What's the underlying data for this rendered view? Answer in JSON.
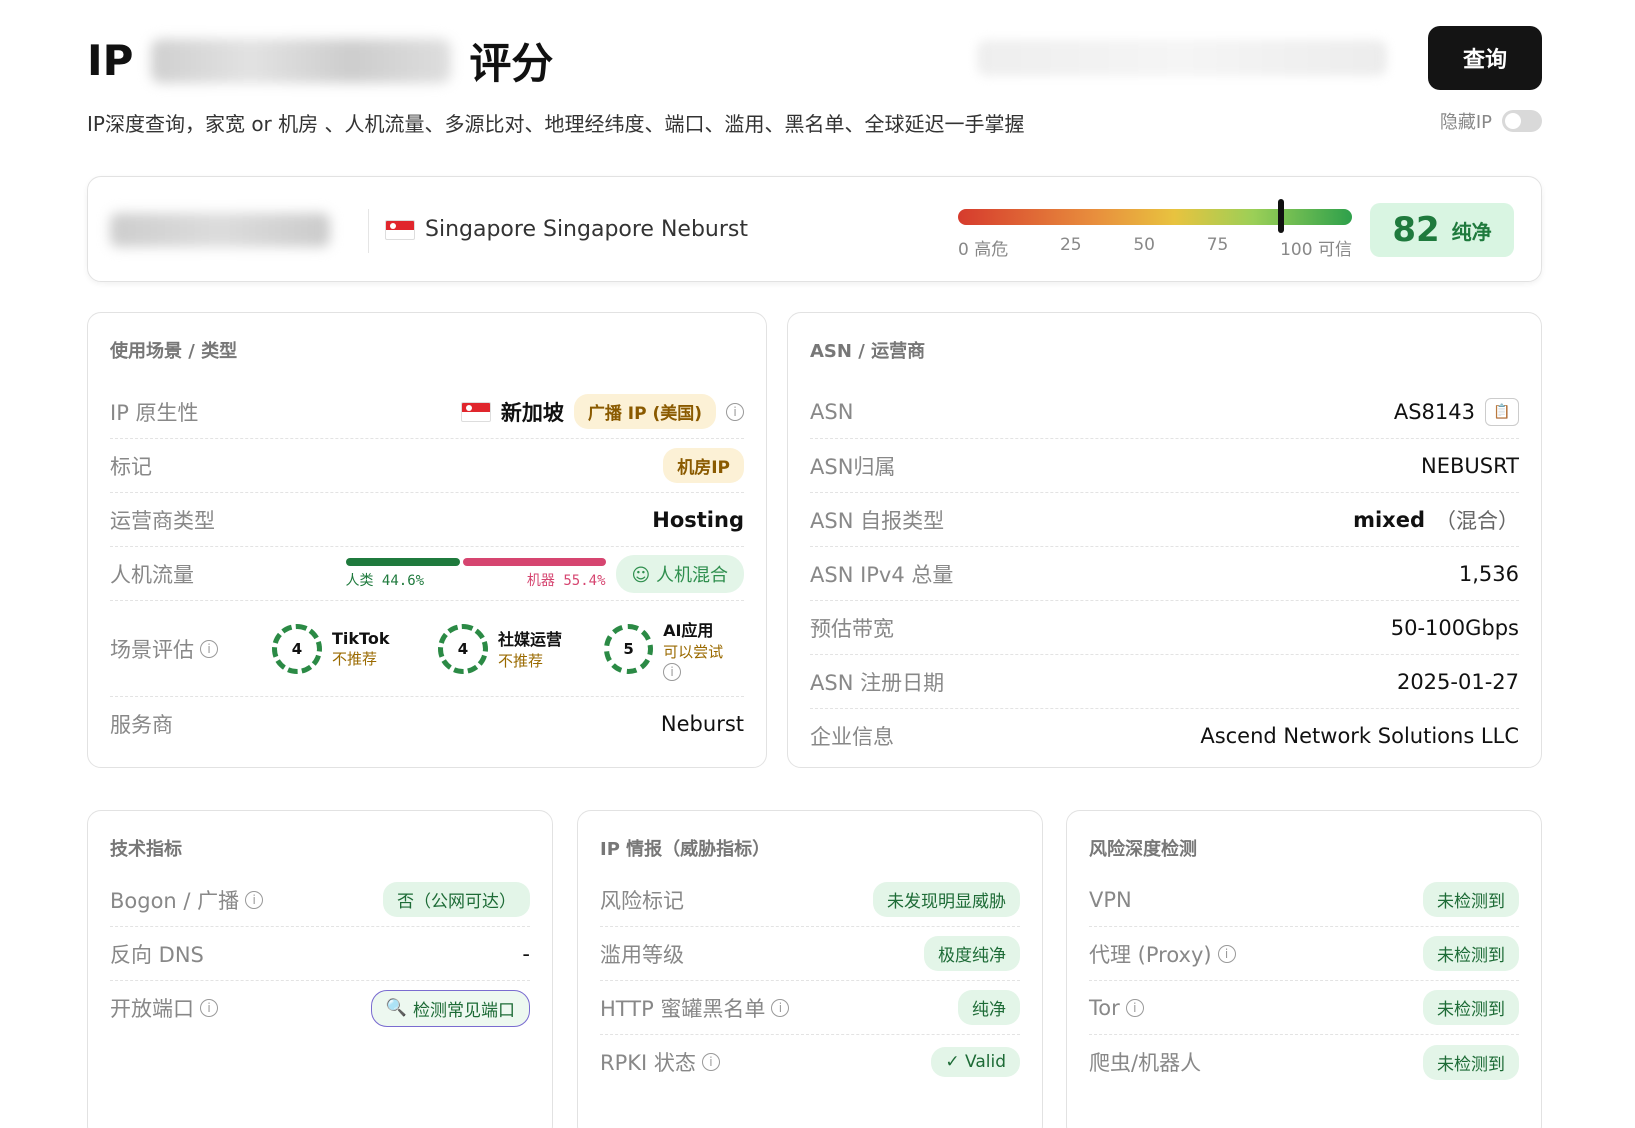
{
  "header": {
    "title_prefix": "IP",
    "title_suffix": "评分",
    "query_button": "查询",
    "subtitle": "IP深度查询，家宽 or 机房 、人机流量、多源比对、地理经纬度、端口、滥用、黑名单、全球延迟一手掌握",
    "hide_ip_label": "隐藏IP"
  },
  "summary": {
    "location": "Singapore Singapore Neburst",
    "gauge_ticks": [
      "0 高危",
      "25",
      "50",
      "75",
      "100 可信"
    ],
    "score": 82,
    "score_label": "纯净"
  },
  "usage": {
    "title": "使用场景 / 类型",
    "native_label": "IP 原生性",
    "native_country": "新加坡",
    "native_badge": "广播 IP (美国)",
    "tag_label": "标记",
    "tag_value": "机房IP",
    "carrier_type_label": "运营商类型",
    "carrier_type_value": "Hosting",
    "traffic_label": "人机流量",
    "human_label": "人类 44.6%",
    "bot_label": "机器 55.4%",
    "human_pct": 44.6,
    "bot_pct": 55.4,
    "traffic_verdict": "人机混合",
    "scene_label": "场景评估",
    "scenes": [
      {
        "score": "4",
        "name": "TikTok",
        "verdict": "不推荐"
      },
      {
        "score": "4",
        "name": "社媒运营",
        "verdict": "不推荐"
      },
      {
        "score": "5",
        "name": "AI应用",
        "verdict": "可以尝试"
      }
    ],
    "provider_label": "服务商",
    "provider_value": "Neburst"
  },
  "asn": {
    "title": "ASN / 运营商",
    "rows": [
      {
        "label": "ASN",
        "value": "AS8143"
      },
      {
        "label": "ASN归属",
        "value": "NEBUSRT"
      },
      {
        "label": "ASN 自报类型",
        "value": "mixed",
        "extra": "（混合）"
      },
      {
        "label": "ASN IPv4 总量",
        "value": "1,536"
      },
      {
        "label": "预估带宽",
        "value": "50-100Gbps"
      },
      {
        "label": "ASN 注册日期",
        "value": "2025-01-27"
      },
      {
        "label": "企业信息",
        "value": "Ascend Network Solutions LLC"
      }
    ]
  },
  "tech": {
    "title": "技术指标",
    "bogon_label": "Bogon / 广播",
    "bogon_value": "否（公网可达）",
    "rdns_label": "反向 DNS",
    "rdns_value": "-",
    "ports_label": "开放端口",
    "ports_button": "检测常见端口"
  },
  "threat": {
    "title": "IP 情报（威胁指标）",
    "rows": [
      {
        "label": "风险标记",
        "value": "未发现明显威胁"
      },
      {
        "label": "滥用等级",
        "value": "极度纯净"
      },
      {
        "label": "HTTP 蜜罐黑名单",
        "value": "纯净"
      },
      {
        "label": "RPKI 状态",
        "value": "✓ Valid"
      }
    ]
  },
  "risk": {
    "title": "风险深度检测",
    "rows": [
      {
        "label": "VPN",
        "value": "未检测到"
      },
      {
        "label": "代理 (Proxy)",
        "value": "未检测到"
      },
      {
        "label": "Tor",
        "value": "未检测到"
      },
      {
        "label": "爬虫/机器人",
        "value": "未检测到"
      }
    ]
  }
}
